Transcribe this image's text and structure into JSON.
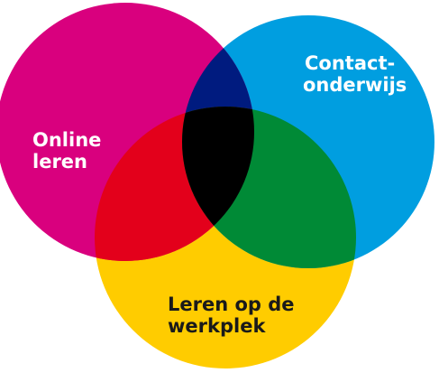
{
  "diagram": {
    "type": "venn",
    "sets": [
      {
        "id": "online",
        "lines": [
          "Online",
          "leren"
        ],
        "color": "#d9007e",
        "text_color": "#ffffff"
      },
      {
        "id": "contact",
        "lines": [
          "Contact-",
          "onderwijs"
        ],
        "color": "#009ee0",
        "text_color": "#ffffff"
      },
      {
        "id": "werkplek",
        "lines": [
          "Leren op de",
          "werkplek"
        ],
        "color": "#ffcc00",
        "text_color": "#1a1a1a"
      }
    ],
    "overlaps": {
      "online_contact": "#001b7f",
      "online_werkplek": "#e3001b",
      "contact_werkplek": "#008a36",
      "all": "#000000"
    }
  }
}
